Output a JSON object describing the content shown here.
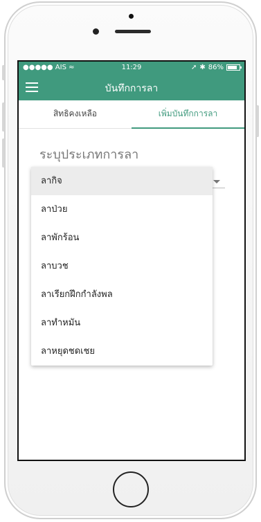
{
  "status_bar": {
    "carrier": "●●●●● AIS",
    "wifi_icon": "wifi-icon",
    "time": "11:29",
    "battery_percent": "86%"
  },
  "app_bar": {
    "title": "บันทึกการลา",
    "menu_icon": "hamburger-icon"
  },
  "tabs": [
    {
      "label": "สิทธิคงเหลือ",
      "active": false
    },
    {
      "label": "เพิ่มบันทึกการลา",
      "active": true
    }
  ],
  "form": {
    "leave_type_label": "ระบุประเภทการลา"
  },
  "leave_type_menu": {
    "selected_index": 0,
    "options": [
      "ลากิจ",
      "ลาป่วย",
      "ลาพักร้อน",
      "ลาบวช",
      "ลาเรียกฝึกกำลังพล",
      "ลาทำหมัน",
      "ลาหยุดชดเชย"
    ]
  },
  "colors": {
    "primary": "#409a7e"
  }
}
